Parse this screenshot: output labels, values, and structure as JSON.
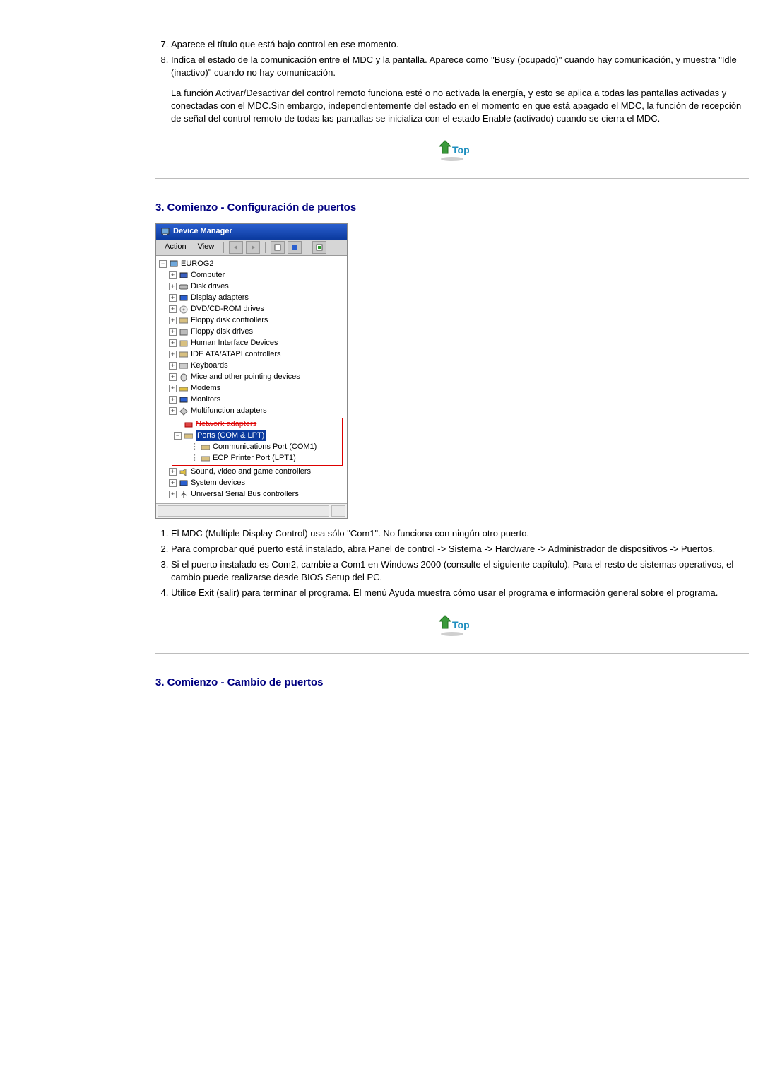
{
  "intro_list": {
    "item7": "Aparece el título que está bajo control en ese momento.",
    "item8": "Indica el estado de la comunicación entre el MDC y la pantalla. Aparece como \"Busy (ocupado)\" cuando hay comunicación, y muestra \"Idle (inactivo)\" cuando no hay comunicación."
  },
  "intro_note": "La función Activar/Desactivar del control remoto funciona esté o no activada la energía, y esto se aplica a todas las pantallas activadas y conectadas con el MDC.Sin embargo, independientemente del estado en el momento en que está apagado el MDC, la función de recepción de señal del control remoto de todas las pantallas se inicializa con el estado Enable (activado) cuando se cierra el MDC.",
  "top_label": "Top",
  "section1_title": "3. Comienzo - Configuración de puertos",
  "devmgr": {
    "title": "Device Manager",
    "menu_action": "Action",
    "menu_view": "View",
    "root": "EUROG2",
    "nodes": {
      "computer": "Computer",
      "disk": "Disk drives",
      "display": "Display adapters",
      "dvd": "DVD/CD-ROM drives",
      "floppyc": "Floppy disk controllers",
      "floppyd": "Floppy disk drives",
      "hid": "Human Interface Devices",
      "ide": "IDE ATA/ATAPI controllers",
      "keyboards": "Keyboards",
      "mice": "Mice and other pointing devices",
      "modems": "Modems",
      "monitors": "Monitors",
      "multifn": "Multifunction adapters",
      "network": "Network adapters",
      "ports": "Ports (COM & LPT)",
      "com1": "Communications Port (COM1)",
      "lpt1": "ECP Printer Port (LPT1)",
      "sound": "Sound, video and game controllers",
      "system": "System devices",
      "usb": "Universal Serial Bus controllers"
    }
  },
  "config_list": {
    "i1": "El MDC (Multiple Display Control) usa sólo \"Com1\". No funciona con ningún otro puerto.",
    "i2": "Para comprobar qué puerto está instalado, abra Panel de control -> Sistema -> Hardware -> Administrador de dispositivos -> Puertos.",
    "i3": "Si el puerto instalado es Com2, cambie a Com1 en Windows 2000 (consulte el siguiente capítulo). Para el resto de sistemas operativos, el cambio puede realizarse desde BIOS Setup del PC.",
    "i4": "Utilice Exit (salir) para terminar el programa. El menú Ayuda muestra cómo usar el programa e información general sobre el programa."
  },
  "section2_title": "3. Comienzo - Cambio de puertos"
}
